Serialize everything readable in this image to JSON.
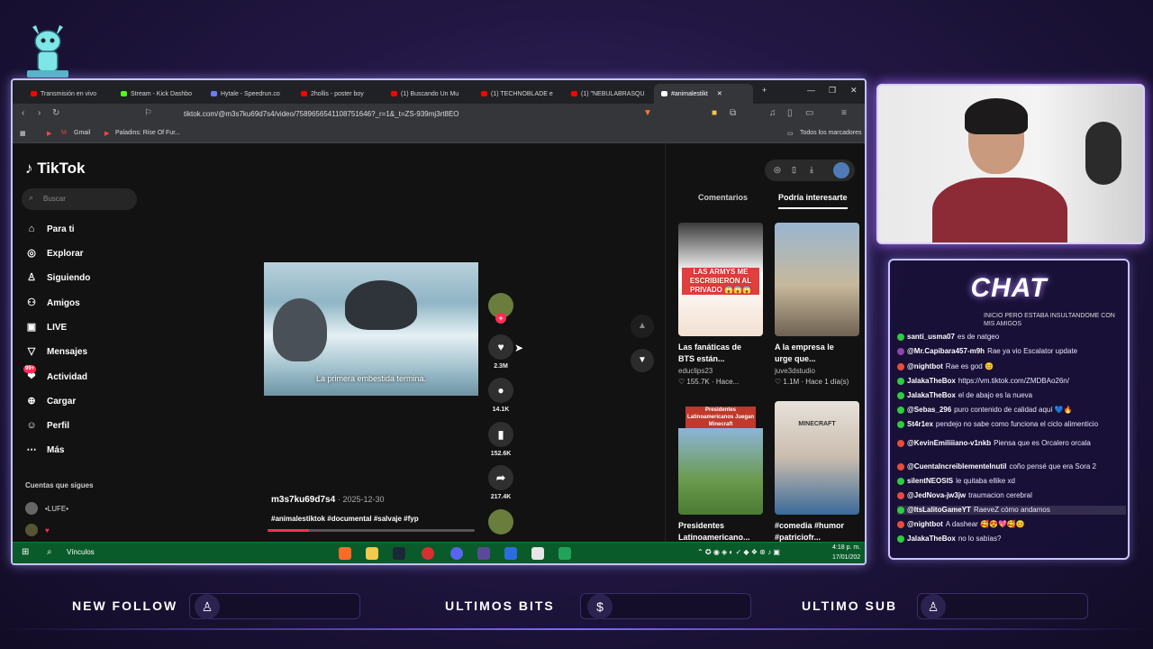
{
  "browser": {
    "tabs": [
      {
        "label": "Transmisión en vivo",
        "color": "#ff0000"
      },
      {
        "label": "Stream - Kick Dashbo",
        "color": "#53fc18"
      },
      {
        "label": "Hytale - Speedrun.co",
        "color": "#6c7cff"
      },
      {
        "label": "2hollis - poster boy",
        "color": "#ff0000"
      },
      {
        "label": "(1) Buscando Un Mu",
        "color": "#ff0000"
      },
      {
        "label": "(1) TECHNOBLADE e",
        "color": "#ff0000"
      },
      {
        "label": "(1) \"NEBULABRASQU",
        "color": "#ff0000"
      },
      {
        "label": "#animalestikt",
        "color": "#ffffff"
      }
    ],
    "tab_close": "✕",
    "new_tab": "+",
    "url": "tiktok.com/@m3s7ku69d7s4/video/7589656541108751646?_r=1&_t=ZS-939mj3rt8EO",
    "bookmarks": {
      "gmail": "Gmail",
      "paladins": "Paladins: Rise Of Fur...",
      "all": "Todos los marcadores"
    }
  },
  "tiktok": {
    "logo": "TikTok",
    "search_placeholder": "Buscar",
    "nav": [
      {
        "label": "Para ti",
        "icon": "home-icon",
        "glyph": "⌂"
      },
      {
        "label": "Explorar",
        "icon": "compass-icon",
        "glyph": "◎"
      },
      {
        "label": "Siguiendo",
        "icon": "following-icon",
        "glyph": "♙"
      },
      {
        "label": "Amigos",
        "icon": "friends-icon",
        "glyph": "⚇"
      },
      {
        "label": "LIVE",
        "icon": "live-icon",
        "glyph": "▣"
      },
      {
        "label": "Mensajes",
        "icon": "messages-icon",
        "glyph": "▽"
      },
      {
        "label": "Actividad",
        "icon": "activity-icon",
        "glyph": "❤",
        "badge": "99+"
      },
      {
        "label": "Cargar",
        "icon": "upload-icon",
        "glyph": "⊕"
      },
      {
        "label": "Perfil",
        "icon": "profile-icon",
        "glyph": "☺"
      },
      {
        "label": "Más",
        "icon": "more-icon",
        "glyph": "⋯"
      }
    ],
    "following_title": "Cuentas que sigues",
    "following": [
      {
        "name": "•LUFE•"
      },
      {
        "name": "♥"
      }
    ],
    "video": {
      "caption": "La primera embestida termina.",
      "author": "m3s7ku69d7s4",
      "date": "· 2025-12-30",
      "tags": "#animalestiktok #documental #salvaje #fyp",
      "progress": 0.2
    },
    "actions": {
      "likes": "2.3M",
      "comments": "14.1K",
      "saves": "152.6K",
      "shares": "217.4K"
    },
    "side": {
      "tab_comments": "Comentarios",
      "tab_suggested": "Podría interesarte",
      "cards": [
        {
          "title": "Las fanáticas de BTS están...",
          "user": "educlips23",
          "stats": "♡ 155.7K · Hace...",
          "overlay": "LAS ARMYS ME ESCRIBIERON AL PRIVADO 😱😱😱"
        },
        {
          "title": "A la empresa le urge que...",
          "user": "juve3dstudio",
          "stats": "♡ 1.1M · Hace 1 día(s)",
          "overlay": ""
        },
        {
          "title": "Presidentes Latinoamericano...",
          "user": "",
          "stats": "",
          "overlay": "Presidentes Latinoamericanos Juegan Minecraft"
        },
        {
          "title": "#comedia #humor #patriciofr...",
          "user": "",
          "stats": "",
          "overlay": "MINECRAFT"
        }
      ]
    }
  },
  "taskbar": {
    "search": "Vínculos",
    "time": "4:18 p. m.",
    "date": "17/01/202"
  },
  "chat": {
    "title": "CHAT",
    "overflow": "INICIO PERO ESTABA INSULTANDOME CON MIS AMIGOS",
    "messages": [
      {
        "user": "santi_usma07",
        "text": "es de natgeo",
        "color": "#2ecc40"
      },
      {
        "user": "@Mr.Capibara457-m9h",
        "text": "Rae ya vio Escalator update",
        "color": "#8e44ad"
      },
      {
        "user": "@nightbot",
        "text": "Rae es god 😊",
        "color": "#e74c3c"
      },
      {
        "user": "JalakaTheBox",
        "text": "https://vm.tiktok.com/ZMDBAo26n/",
        "color": "#2ecc40"
      },
      {
        "user": "JalakaTheBox",
        "text": "el de abajo es la nueva",
        "color": "#2ecc40"
      },
      {
        "user": "@Sebas_296",
        "text": "puro contenido de calidad aquí 💙🔥",
        "color": "#2ecc40"
      },
      {
        "user": "St4r1ex",
        "text": "pendejo no sabe como funciona el ciclo alimenticio",
        "color": "#2ecc40"
      },
      {
        "user": "@KevinEmiliiiano-v1nkb",
        "text": "Piensa que es Orcalero orcala",
        "color": "#e74c3c"
      },
      {
        "user": "@CuentaIncreiblementeInutil",
        "text": "coño pensé que era Sora 2",
        "color": "#e74c3c"
      },
      {
        "user": "silentNEOSIS",
        "text": "le quitaba ellike xd",
        "color": "#2ecc40"
      },
      {
        "user": "@JedNova-jw3jw",
        "text": "traumacion cerebral",
        "color": "#e74c3c"
      },
      {
        "user": "@ItsLalitoGameYT",
        "text": "RaeveZ cómo andamos",
        "color": "#2ecc40"
      },
      {
        "user": "@nightbot",
        "text": "A dashear 🥰😍💖🥰😊",
        "color": "#e74c3c"
      },
      {
        "user": "JalakaTheBox",
        "text": "no lo sabías?",
        "color": "#2ecc40"
      }
    ]
  },
  "bottom": {
    "new_follow": "NEW FOLLOW",
    "ultimos_bits": "ULTIMOS BITS",
    "ultimo_sub": "ULTIMO SUB"
  }
}
